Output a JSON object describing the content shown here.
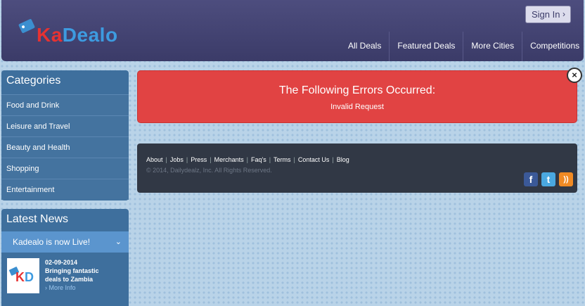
{
  "header": {
    "logo_ka": "Ka",
    "logo_dealo": "Dealo",
    "signin_label": "Sign In",
    "nav": [
      "All Deals",
      "Featured Deals",
      "More Cities",
      "Competitions"
    ]
  },
  "categories": {
    "title": "Categories",
    "items": [
      "Food and Drink",
      "Leisure and Travel",
      "Beauty and Health",
      "Shopping",
      "Entertainment"
    ]
  },
  "news": {
    "title": "Latest News",
    "headline": "Kadealo is now Live!",
    "thumb_k": "K",
    "thumb_d": "D",
    "date": "02-09-2014",
    "text": "Bringing fantastic deals to Zambia",
    "more": "More Info"
  },
  "error": {
    "title": "The Following Errors Occurred:",
    "message": "Invalid Request",
    "close": "×"
  },
  "footer": {
    "links": [
      "About",
      "Jobs",
      "Press",
      "Merchants",
      "Faq's",
      "Terms",
      "Contact Us",
      "Blog"
    ],
    "separator": "|",
    "copyright": "© 2014, Dailydealz, Inc. All Rights Reserved.",
    "social": [
      "facebook-icon",
      "twitter-icon",
      "rss-icon"
    ]
  },
  "colors": {
    "header_bg": "#3b3b68",
    "sidebar_bg": "#3e6f9d",
    "error_bg": "#e14343",
    "footer_bg": "#313845"
  }
}
